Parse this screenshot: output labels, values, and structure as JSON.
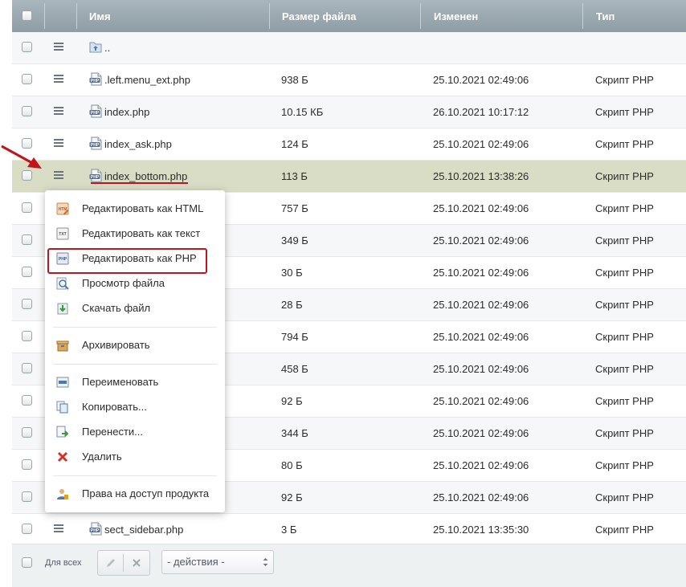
{
  "header": {
    "col_name": "Имя",
    "col_size": "Размер файла",
    "col_modified": "Изменен",
    "col_type": "Тип"
  },
  "rows": [
    {
      "name": "..",
      "size": "",
      "modified": "",
      "type": "",
      "icon": "folder-up-icon"
    },
    {
      "name": ".left.menu_ext.php",
      "size": "938 Б",
      "modified": "25.10.2021 02:49:06",
      "type": "Скрипт PHP",
      "icon": "php-file-icon"
    },
    {
      "name": "index.php",
      "size": "10.15 КБ",
      "modified": "26.10.2021 10:17:12",
      "type": "Скрипт PHP",
      "icon": "php-file-icon"
    },
    {
      "name": "index_ask.php",
      "size": "124 Б",
      "modified": "25.10.2021 02:49:06",
      "type": "Скрипт PHP",
      "icon": "php-file-icon"
    },
    {
      "name": "index_bottom.php",
      "size": "113 Б",
      "modified": "25.10.2021 13:38:26",
      "type": "Скрипт PHP",
      "icon": "php-file-icon"
    },
    {
      "name": "",
      "size": "757 Б",
      "modified": "25.10.2021 02:49:06",
      "type": "Скрипт PHP",
      "icon": ""
    },
    {
      "name": "",
      "size": "349 Б",
      "modified": "25.10.2021 02:49:06",
      "type": "Скрипт PHP",
      "icon": ""
    },
    {
      "name": "",
      "size": "30 Б",
      "modified": "25.10.2021 02:49:06",
      "type": "Скрипт PHP",
      "icon": ""
    },
    {
      "name": "",
      "size": "28 Б",
      "modified": "25.10.2021 02:49:06",
      "type": "Скрипт PHP",
      "icon": ""
    },
    {
      "name": "",
      "size": "794 Б",
      "modified": "25.10.2021 02:49:06",
      "type": "Скрипт PHP",
      "icon": ""
    },
    {
      "name": "",
      "size": "458 Б",
      "modified": "25.10.2021 02:49:06",
      "type": "Скрипт PHP",
      "icon": ""
    },
    {
      "name": "",
      "size": "92 Б",
      "modified": "25.10.2021 02:49:06",
      "type": "Скрипт PHP",
      "icon": ""
    },
    {
      "name": "",
      "size": "344 Б",
      "modified": "25.10.2021 02:49:06",
      "type": "Скрипт PHP",
      "icon": ""
    },
    {
      "name": "",
      "size": "80 Б",
      "modified": "25.10.2021 02:49:06",
      "type": "Скрипт PHP",
      "icon": ""
    },
    {
      "name": "",
      "size": "92 Б",
      "modified": "25.10.2021 02:49:06",
      "type": "Скрипт PHP",
      "icon": ""
    },
    {
      "name": "sect_sidebar.php",
      "size": "3 Б",
      "modified": "25.10.2021 13:35:30",
      "type": "Скрипт PHP",
      "icon": "php-file-icon"
    }
  ],
  "context_menu": {
    "items": [
      {
        "label": "Редактировать как HTML",
        "icon": "edit-html-icon"
      },
      {
        "label": "Редактировать как текст",
        "icon": "edit-text-icon"
      },
      {
        "label": "Редактировать как PHP",
        "icon": "edit-php-icon"
      },
      {
        "label": "Просмотр файла",
        "icon": "view-file-icon"
      },
      {
        "label": "Скачать файл",
        "icon": "download-icon"
      },
      {
        "label": "Архивировать",
        "icon": "archive-icon"
      },
      {
        "label": "Переименовать",
        "icon": "rename-icon"
      },
      {
        "label": "Копировать...",
        "icon": "copy-icon"
      },
      {
        "label": "Перенести...",
        "icon": "move-icon"
      },
      {
        "label": "Удалить",
        "icon": "delete-icon"
      },
      {
        "label": "Права на доступ продукта",
        "icon": "access-rights-icon"
      }
    ]
  },
  "footer": {
    "for_all_label": "Для всех",
    "actions_select": "- действия -"
  },
  "colors": {
    "header_bg": "#9aa7ae",
    "selected_row": "#d9ddc6",
    "annotation_red": "#c0151c"
  }
}
